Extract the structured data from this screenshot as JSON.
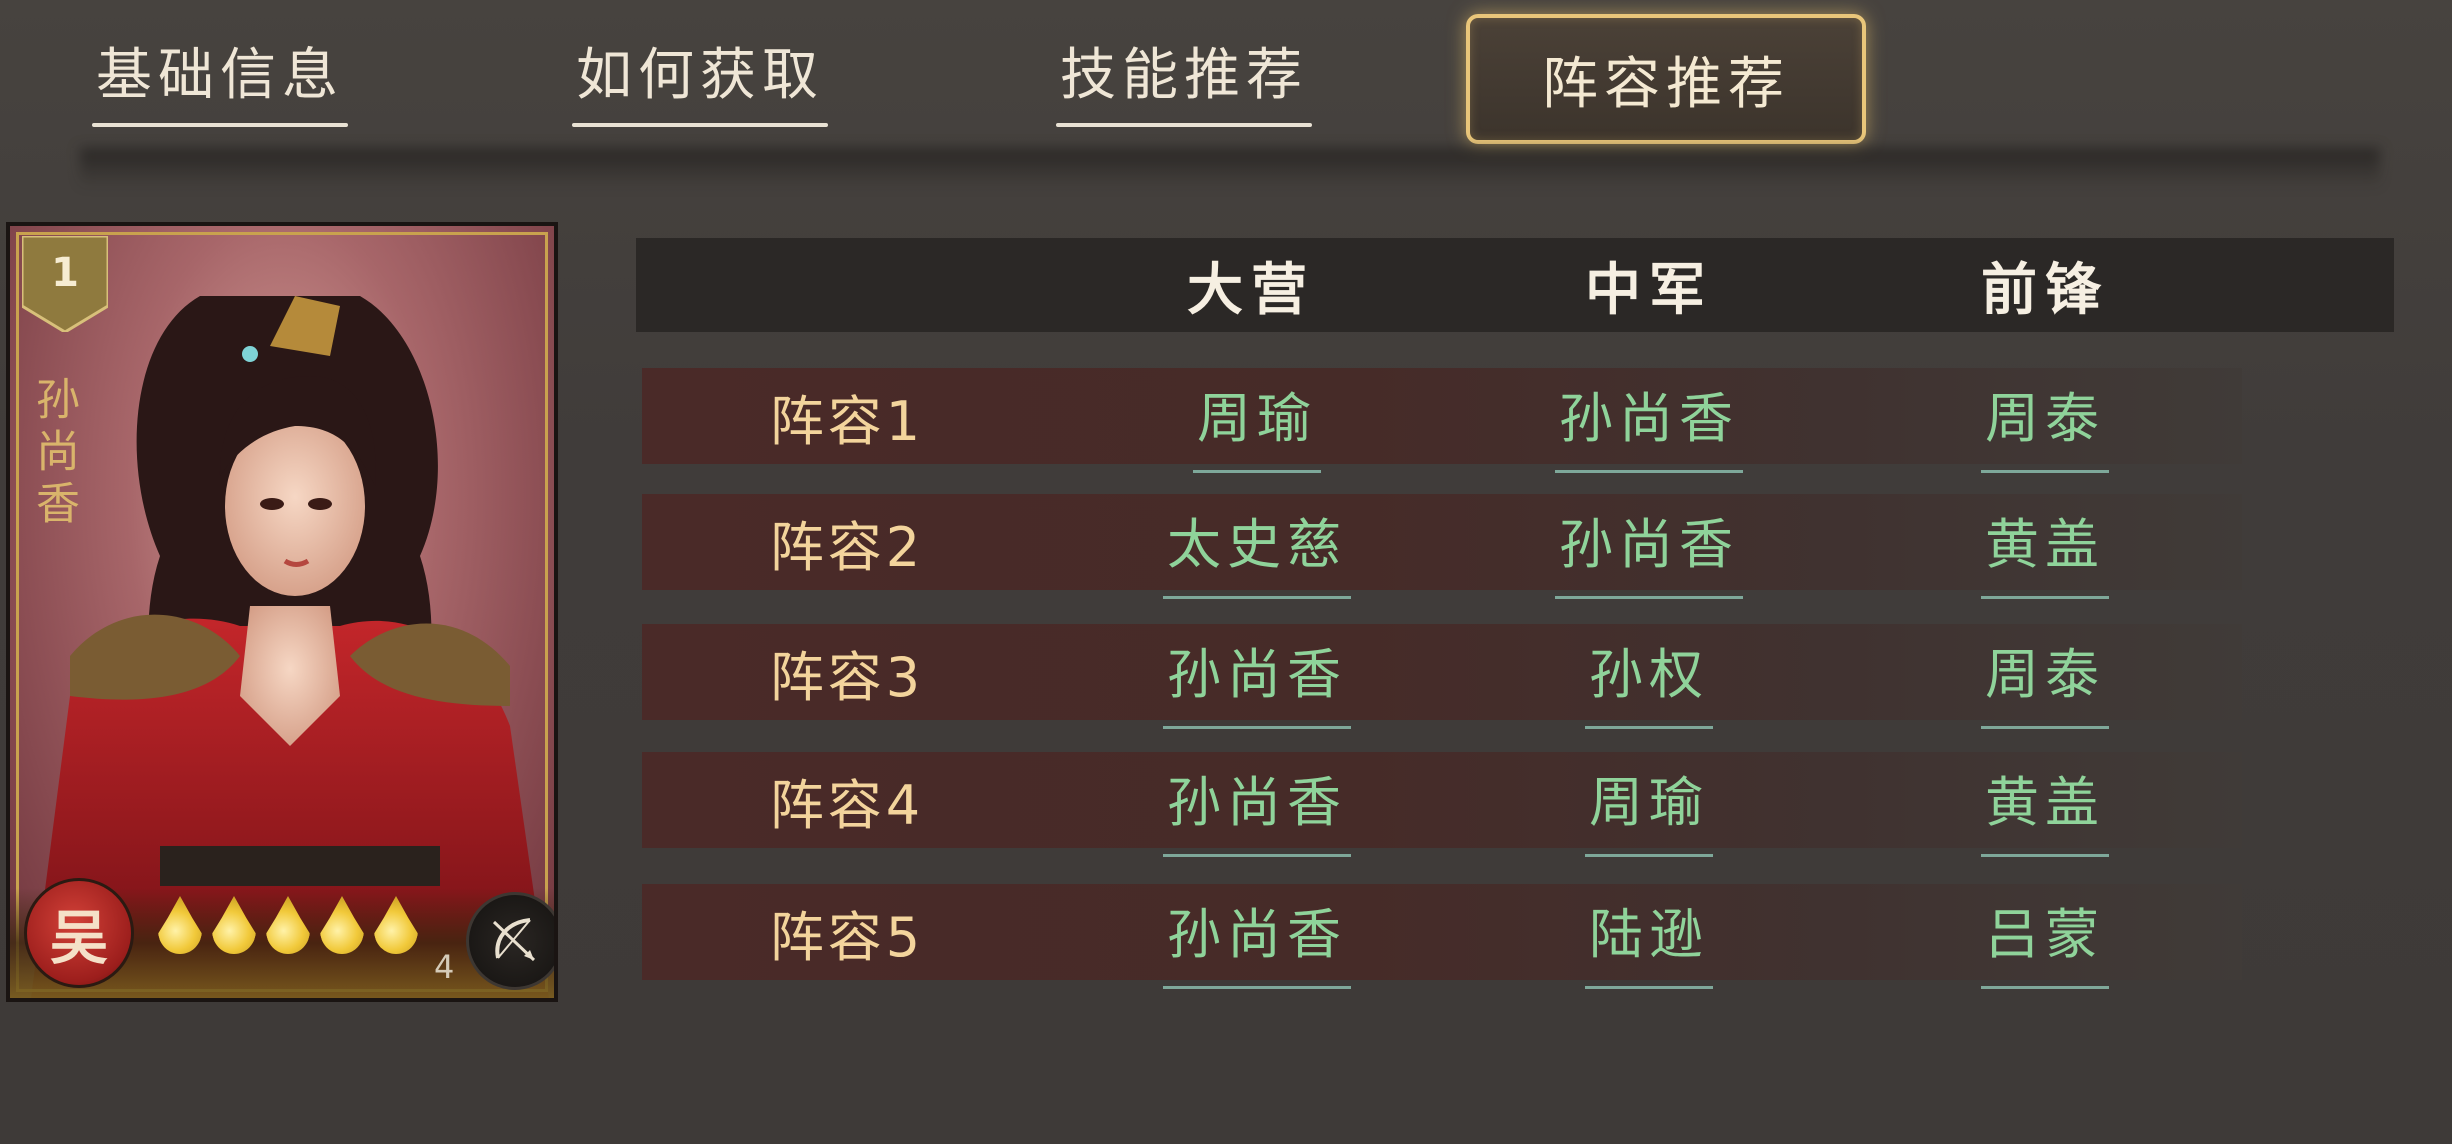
{
  "tabs": [
    {
      "label": "基础信息",
      "active": false
    },
    {
      "label": "如何获取",
      "active": false
    },
    {
      "label": "技能推荐",
      "active": false
    },
    {
      "label": "阵容推荐",
      "active": true
    }
  ],
  "card": {
    "rank": "1",
    "name": "孙尚香",
    "faction": "吴",
    "star_count": 5,
    "cost": "4",
    "class_icon": "bow-icon",
    "colors": {
      "frame_gold": "#c9a24e",
      "faction_red": "#b82a25"
    }
  },
  "table": {
    "columns": [
      "大营",
      "中军",
      "前锋"
    ],
    "rows": [
      {
        "label": "阵容1",
        "heroes": [
          "周瑜",
          "孙尚香",
          "周泰"
        ]
      },
      {
        "label": "阵容2",
        "heroes": [
          "太史慈",
          "孙尚香",
          "黄盖"
        ]
      },
      {
        "label": "阵容3",
        "heroes": [
          "孙尚香",
          "孙权",
          "周泰"
        ]
      },
      {
        "label": "阵容4",
        "heroes": [
          "孙尚香",
          "周瑜",
          "黄盖"
        ]
      },
      {
        "label": "阵容5",
        "heroes": [
          "孙尚香",
          "陆逊",
          "吕蒙"
        ]
      }
    ],
    "colors": {
      "hero_link": "#8fd39a",
      "row_label": "#f3d49c"
    }
  }
}
